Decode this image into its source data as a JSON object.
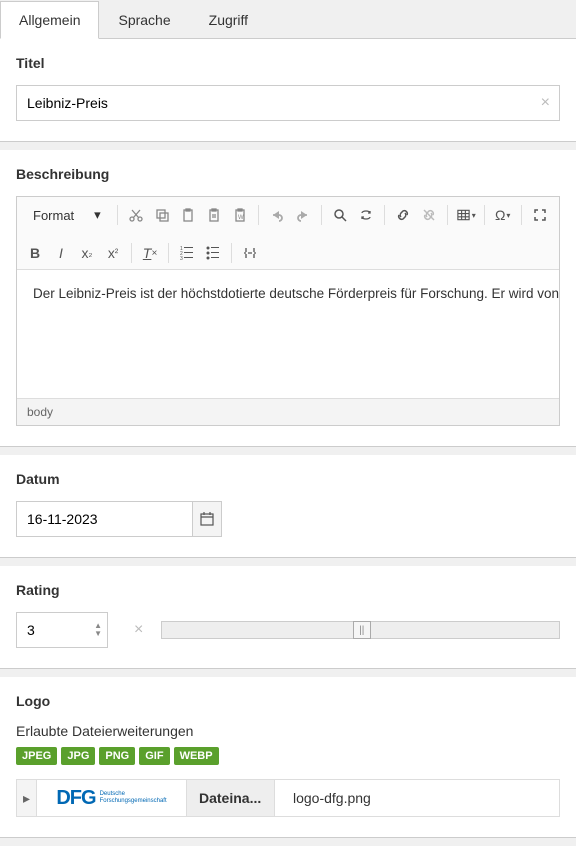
{
  "tabs": [
    {
      "label": "Allgemein",
      "active": true
    },
    {
      "label": "Sprache",
      "active": false
    },
    {
      "label": "Zugriff",
      "active": false
    }
  ],
  "titel": {
    "label": "Titel",
    "value": "Leibniz-Preis"
  },
  "beschreibung": {
    "label": "Beschreibung",
    "format_label": "Format",
    "content": "Der Leibniz-Preis ist der höchstdotierte deutsche Förderpreis für Forschung. Er wird von der",
    "path": "body"
  },
  "datum": {
    "label": "Datum",
    "value": "16-11-2023"
  },
  "rating": {
    "label": "Rating",
    "value": "3"
  },
  "logo": {
    "label": "Logo",
    "extensions_label": "Erlaubte Dateierweiterungen",
    "extensions": [
      "JPEG",
      "JPG",
      "PNG",
      "GIF",
      "WEBP"
    ],
    "file_label": "Dateina...",
    "file_name": "logo-dfg.png",
    "thumb_text_big": "DFG",
    "thumb_text_small_1": "Deutsche",
    "thumb_text_small_2": "Forschungsgemeinschaft"
  }
}
